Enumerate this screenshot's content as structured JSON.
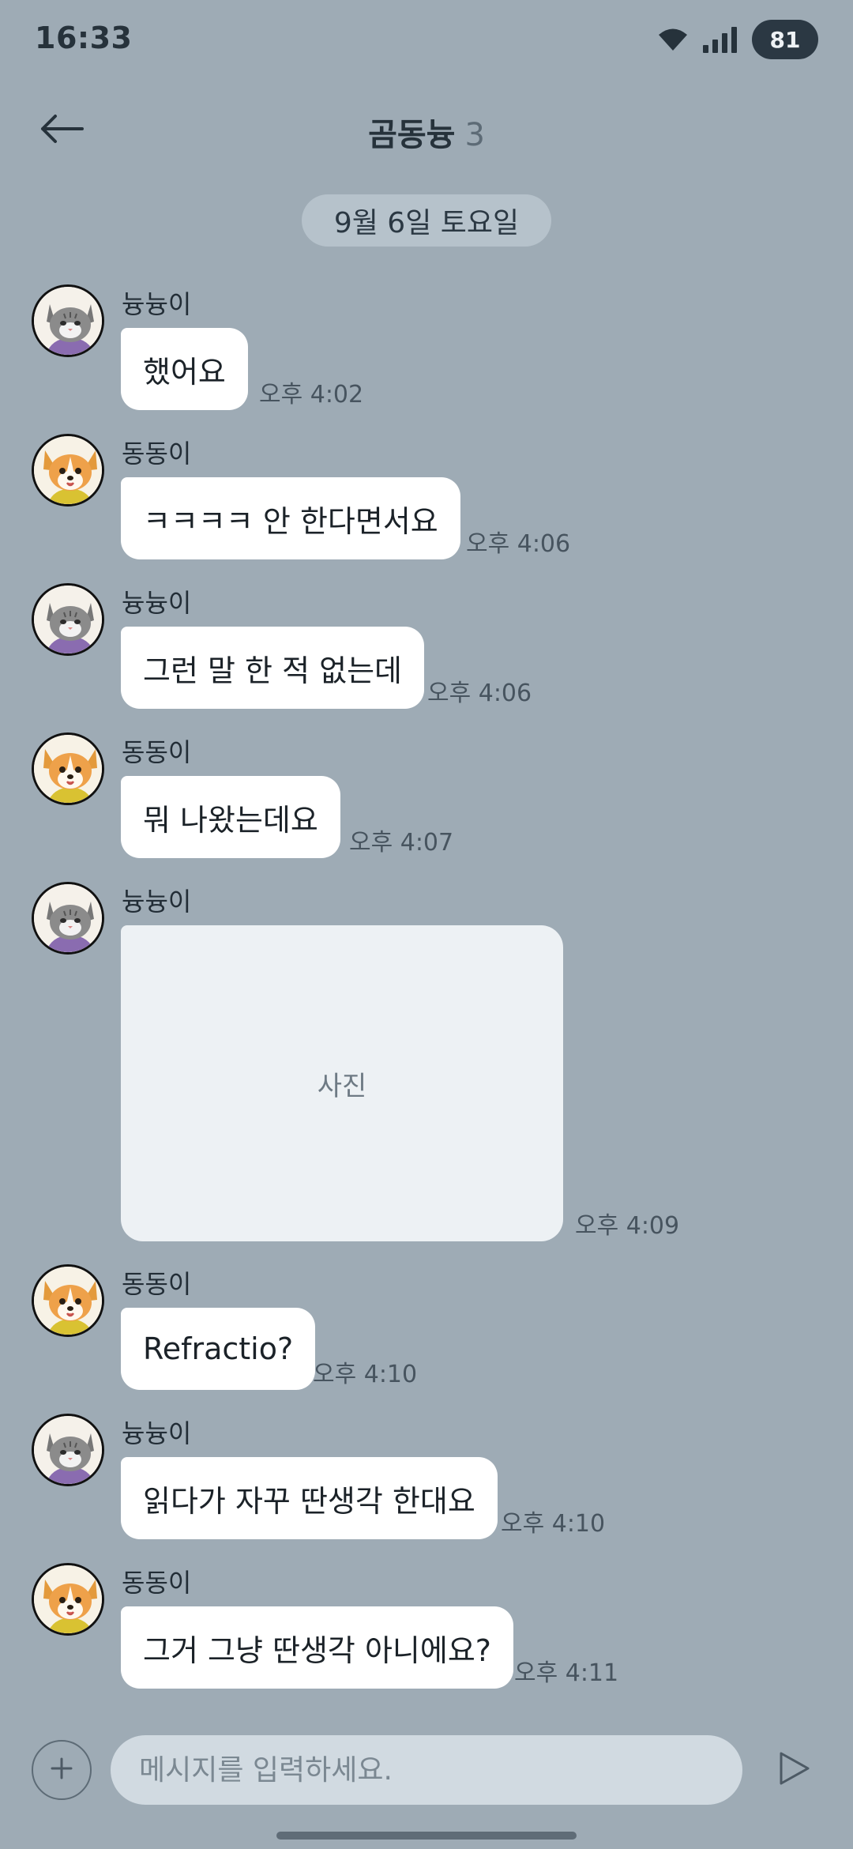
{
  "status_bar": {
    "time": "16:33",
    "battery": "81",
    "icons": [
      "wifi-icon",
      "signal-icon"
    ]
  },
  "header": {
    "title": "곰동늉",
    "member_count": "3",
    "back_icon": "arrow-left-icon"
  },
  "date_divider": "9월 6일 토요일",
  "messages": [
    {
      "sender": "늉늉이",
      "avatar": "cat-avatar",
      "text": "했어요",
      "time": "오후 4:02"
    },
    {
      "sender": "동동이",
      "avatar": "dog-avatar",
      "text": "ㅋㅋㅋㅋ 안 한다면서요",
      "time": "오후 4:06"
    },
    {
      "sender": "늉늉이",
      "avatar": "cat-avatar",
      "text": "그런 말 한 적 없는데",
      "time": "오후 4:06"
    },
    {
      "sender": "동동이",
      "avatar": "dog-avatar",
      "text": "뭐 나왔는데요",
      "time": "오후 4:07"
    },
    {
      "sender": "늉늉이",
      "avatar": "cat-avatar",
      "photo_label": "사진",
      "time": "오후 4:09"
    },
    {
      "sender": "동동이",
      "avatar": "dog-avatar",
      "text": "Refractio?",
      "time": "오후 4:10"
    },
    {
      "sender": "늉늉이",
      "avatar": "cat-avatar",
      "text": "읽다가 자꾸 딴생각 한대요",
      "time": "오후 4:10"
    },
    {
      "sender": "동동이",
      "avatar": "dog-avatar",
      "text": "그거 그냥 딴생각 아니에요?",
      "time": "오후 4:11"
    }
  ],
  "input": {
    "placeholder": "메시지를 입력하세요.",
    "value": ""
  },
  "colors": {
    "background": "#9eabb5",
    "bubble": "#ffffff",
    "date_chip": "#b6c2cb",
    "input_field": "#d1dae1"
  }
}
